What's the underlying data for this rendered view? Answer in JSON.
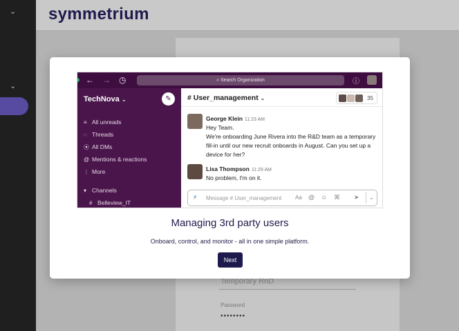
{
  "app": {
    "logo": "symmetrium",
    "bg_form": {
      "field_value": "Temporary RnD",
      "password_label": "Password",
      "password_value": "••••••••"
    }
  },
  "slack_preview": {
    "search_placeholder": "Search Organization",
    "workspace": "TechNova",
    "nav": [
      {
        "icon": "≡",
        "label": "All unreads"
      },
      {
        "icon": "◌",
        "label": "Threads"
      },
      {
        "icon": "⦿",
        "label": "All DMs"
      },
      {
        "icon": "@",
        "label": "Mentions & reactions"
      },
      {
        "icon": "⋮",
        "label": "More"
      },
      {
        "icon": "▾",
        "label": "Channels"
      },
      {
        "icon": "#",
        "label": "Belleview_IT"
      }
    ],
    "channel": "# User_management",
    "member_count": "35",
    "messages": [
      {
        "name": "George Klein",
        "time": "11:23 AM",
        "lines": [
          "Hey Team.",
          "We're onboarding June Rivera into the R&D team as a temporary fill-in until our new recruit onboards in August. Can you set up a device for her?"
        ]
      },
      {
        "name": "Lisa Thompson",
        "time": "11:29 AM",
        "lines": [
          "No problem, I'm on it."
        ]
      }
    ],
    "composer_placeholder": "Message # User_management"
  },
  "modal": {
    "title": "Managing 3rd party users",
    "subtitle": "Onboard, control, and monitor - all in one simple platform.",
    "next_label": "Next"
  },
  "colors": {
    "brand_dark": "#1e1a4d",
    "slack_aubergine": "#4a154b",
    "accent_purple": "#6a5acd"
  }
}
